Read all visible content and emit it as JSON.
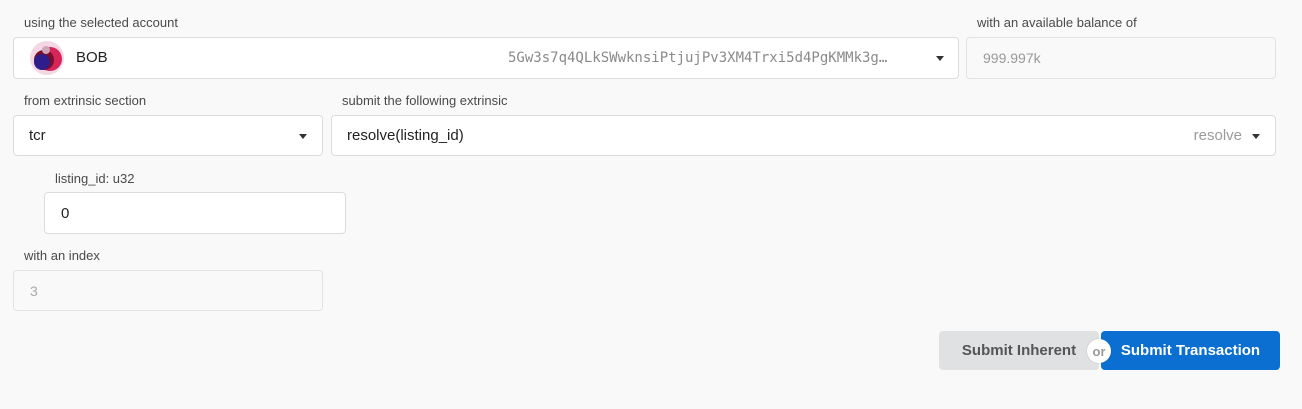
{
  "account": {
    "label": "using the selected account",
    "name": "BOB",
    "address": "5Gw3s7q4QLkSWwknsiPtjujPv3XM4Trxi5d4PgKMMk3g…",
    "avatar_icon": "identicon"
  },
  "balance": {
    "label": "with an available balance of",
    "value": "999.997k"
  },
  "section": {
    "label": "from extrinsic section",
    "value": "tcr"
  },
  "extrinsic": {
    "label": "submit the following extrinsic",
    "value": "resolve(listing_id)",
    "method": "resolve"
  },
  "param": {
    "label": "listing_id: u32",
    "value": "0"
  },
  "nonce": {
    "label": "with an index",
    "value": "3"
  },
  "actions": {
    "inherent_label": "Submit Inherent",
    "or_label": "or",
    "transaction_label": "Submit Transaction"
  },
  "colors": {
    "primary": "#0b6fd1",
    "secondary_bg": "#e0e1e2"
  }
}
